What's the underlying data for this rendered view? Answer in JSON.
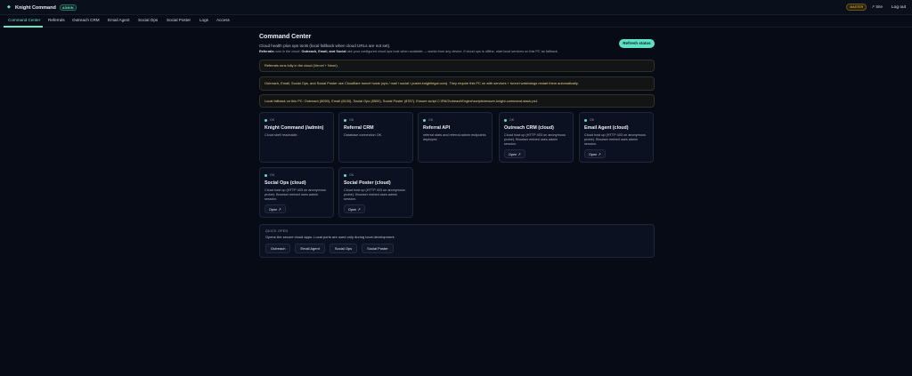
{
  "header": {
    "brand_name": "Knight Command",
    "brand_badge": "ADMIN",
    "role_chip": "MASTER",
    "site_link": "↗ Site",
    "logout": "Log out"
  },
  "tabs": [
    {
      "label": "Command Center"
    },
    {
      "label": "Referrals"
    },
    {
      "label": "Outreach CRM"
    },
    {
      "label": "Email Agent"
    },
    {
      "label": "Social Ops"
    },
    {
      "label": "Social Poster"
    },
    {
      "label": "Logs"
    },
    {
      "label": "Access"
    }
  ],
  "main": {
    "title": "Command Center",
    "subtitle": "Cloud health plus ops tools (local fallback when cloud URLs are not set).",
    "note_bold_1": "Referrals",
    "note_1": " runs in the cloud. ",
    "note_bold_2": "Outreach, Email, and Social",
    "note_2": " use your configured cloud ops host when available — works from any device. If cloud ops is offline, start local services on this PC as fallback.",
    "refresh_label": "Refresh status"
  },
  "banners": {
    "b1": "Referrals runs fully in the cloud (Vercel + Neon).",
    "b2": "Outreach, Email, Social Ops, and Social Poster use Cloudflare tunnel hosts (ops / mail / social / poster.knightlegal.com). They require this PC on with services + tunnel watchdogs restart them automatically.",
    "b3": "Local fallback on this PC: Outreach (8050), Email (8100), Social Ops (8500), Social Poster (8787). Ensure script C:\\RAO\\utreachEngine\\scripts\\ensure-knight-command-stack.ps1"
  },
  "cards": [
    {
      "status": "OK",
      "title": "Knight Command (/admin)",
      "desc": "Cloud shell reachable.",
      "open": ""
    },
    {
      "status": "OK",
      "title": "Referral CRM",
      "desc": "Database connection OK.",
      "open": ""
    },
    {
      "status": "OK",
      "title": "Referral API",
      "desc": "referral stats and referral admin endpoints deployed.",
      "open": ""
    },
    {
      "status": "OK",
      "title": "Outreach CRM (cloud)",
      "desc": "Cloud host up (HTTP 403 on anonymous probe). Browser embed uses admin session.",
      "open": "Open ↗"
    },
    {
      "status": "OK",
      "title": "Email Agent (cloud)",
      "desc": "Cloud host up (HTTP 403 on anonymous probe). Browser embed uses admin session.",
      "open": "Open ↗"
    },
    {
      "status": "OK",
      "title": "Social Ops (cloud)",
      "desc": "Cloud host up (HTTP 403 on anonymous probe). Browser embed uses admin session.",
      "open": "Open ↗"
    },
    {
      "status": "OK",
      "title": "Social Poster (cloud)",
      "desc": "Cloud host up (HTTP 403 on anonymous probe). Browser embed uses admin session.",
      "open": "Open ↗"
    }
  ],
  "quick_open": {
    "label": "QUICK OPEN",
    "desc": "Opens the secure cloud apps. Local ports are used only during local development.",
    "buttons": [
      "Outreach",
      "Email Agent",
      "Social Ops",
      "Social Poster"
    ]
  },
  "colors": {
    "accent": "#5fe0c6",
    "background": "#070b16",
    "warning_text": "#e9d38a"
  }
}
